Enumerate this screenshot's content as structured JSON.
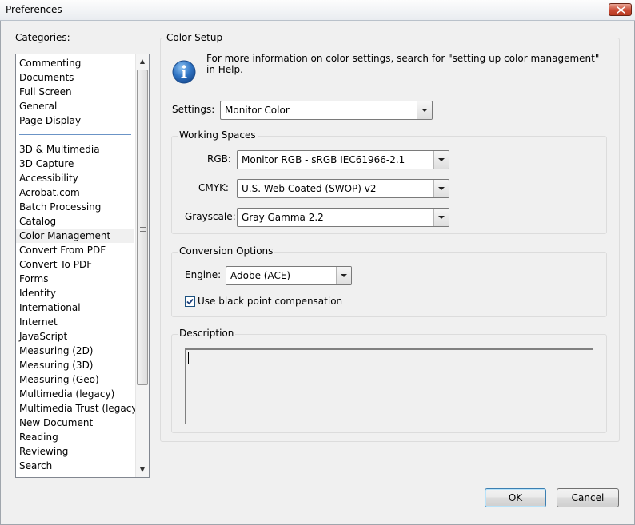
{
  "window": {
    "title": "Preferences"
  },
  "categories": {
    "label": "Categories:",
    "selected": "Color Management",
    "top_items": [
      "Commenting",
      "Documents",
      "Full Screen",
      "General",
      "Page Display"
    ],
    "items": [
      "3D & Multimedia",
      "3D Capture",
      "Accessibility",
      "Acrobat.com",
      "Batch Processing",
      "Catalog",
      "Color Management",
      "Convert From PDF",
      "Convert To PDF",
      "Forms",
      "Identity",
      "International",
      "Internet",
      "JavaScript",
      "Measuring (2D)",
      "Measuring (3D)",
      "Measuring (Geo)",
      "Multimedia (legacy)",
      "Multimedia Trust (legacy)",
      "New Document",
      "Reading",
      "Reviewing",
      "Search"
    ]
  },
  "color_setup": {
    "title": "Color Setup",
    "info_text": "For more information on color settings, search for \"setting up color management\" in Help.",
    "settings_label": "Settings:",
    "settings_value": "Monitor Color"
  },
  "working_spaces": {
    "title": "Working Spaces",
    "rgb_label": "RGB:",
    "rgb_value": "Monitor RGB - sRGB IEC61966-2.1",
    "cmyk_label": "CMYK:",
    "cmyk_value": "U.S. Web Coated (SWOP) v2",
    "gray_label": "Grayscale:",
    "gray_value": "Gray Gamma 2.2"
  },
  "conversion": {
    "title": "Conversion Options",
    "engine_label": "Engine:",
    "engine_value": "Adobe (ACE)",
    "bpc_label": "Use black point compensation",
    "bpc_checked": true
  },
  "description": {
    "title": "Description"
  },
  "buttons": {
    "ok": "OK",
    "cancel": "Cancel"
  }
}
